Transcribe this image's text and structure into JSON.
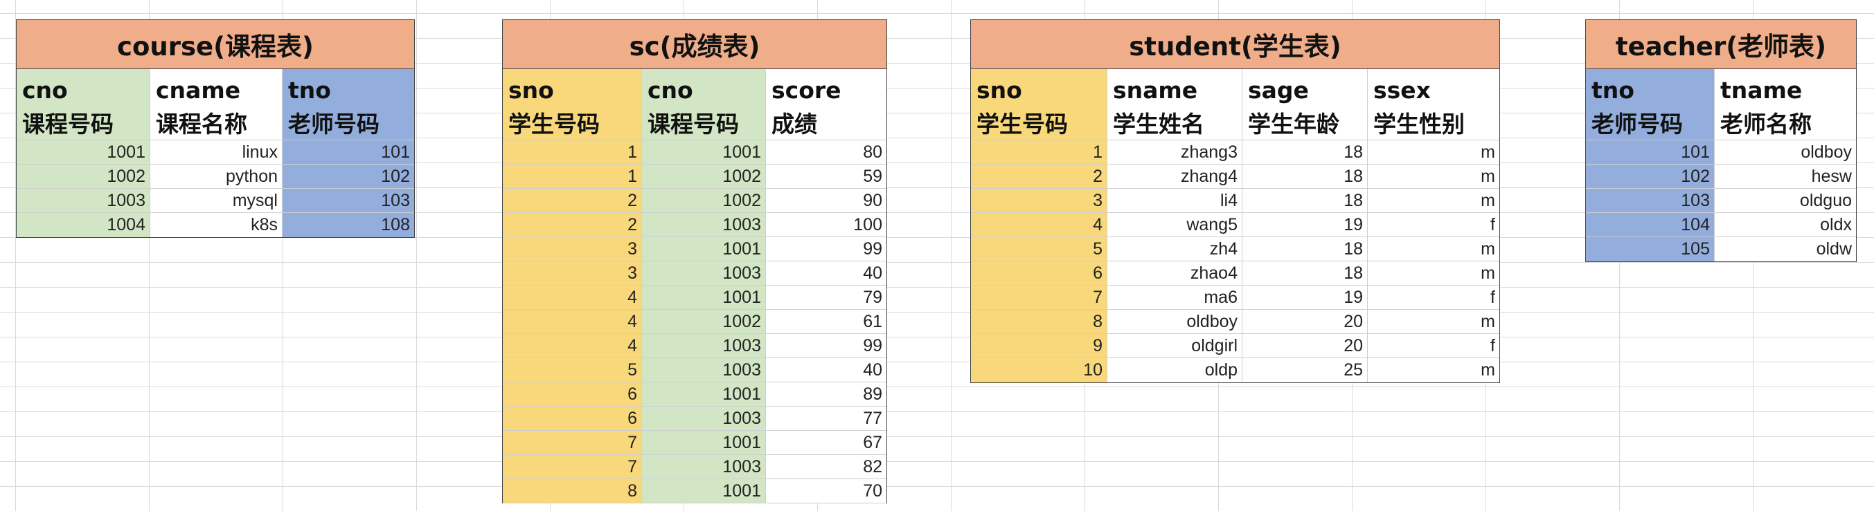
{
  "colors": {
    "title_bg": "#efad8a",
    "yellow": "#f8d87a",
    "green": "#d2e6c6",
    "blue": "#93aedd"
  },
  "course": {
    "title": "course(课程表)",
    "columns": [
      {
        "name": "cno",
        "label": "课程号码",
        "color": "green",
        "values": [
          "1001",
          "1002",
          "1003",
          "1004"
        ]
      },
      {
        "name": "cname",
        "label": "课程名称",
        "color": "white",
        "values": [
          "linux",
          "python",
          "mysql",
          "k8s"
        ]
      },
      {
        "name": "tno",
        "label": "老师号码",
        "color": "blue",
        "values": [
          "101",
          "102",
          "103",
          "108"
        ]
      }
    ]
  },
  "sc": {
    "title": "sc(成绩表)",
    "columns": [
      {
        "name": "sno",
        "label": "学生号码",
        "color": "yellow",
        "values": [
          "1",
          "1",
          "2",
          "2",
          "3",
          "3",
          "4",
          "4",
          "4",
          "5",
          "6",
          "6",
          "7",
          "7",
          "8"
        ]
      },
      {
        "name": "cno",
        "label": "课程号码",
        "color": "green",
        "values": [
          "1001",
          "1002",
          "1002",
          "1003",
          "1001",
          "1003",
          "1001",
          "1002",
          "1003",
          "1003",
          "1001",
          "1003",
          "1001",
          "1003",
          "1001"
        ]
      },
      {
        "name": "score",
        "label": "成绩",
        "color": "white",
        "values": [
          "80",
          "59",
          "90",
          "100",
          "99",
          "40",
          "79",
          "61",
          "99",
          "40",
          "89",
          "77",
          "67",
          "82",
          "70"
        ]
      }
    ]
  },
  "student": {
    "title": "student(学生表)",
    "columns": [
      {
        "name": "sno",
        "label": "学生号码",
        "color": "yellow",
        "values": [
          "1",
          "2",
          "3",
          "4",
          "5",
          "6",
          "7",
          "8",
          "9",
          "10"
        ]
      },
      {
        "name": "sname",
        "label": "学生姓名",
        "color": "white",
        "values": [
          "zhang3",
          "zhang4",
          "li4",
          "wang5",
          "zh4",
          "zhao4",
          "ma6",
          "oldboy",
          "oldgirl",
          "oldp"
        ]
      },
      {
        "name": "sage",
        "label": "学生年龄",
        "color": "white",
        "values": [
          "18",
          "18",
          "18",
          "19",
          "18",
          "18",
          "19",
          "20",
          "20",
          "25"
        ]
      },
      {
        "name": "ssex",
        "label": "学生性别",
        "color": "white",
        "values": [
          "m",
          "m",
          "m",
          "f",
          "m",
          "m",
          "f",
          "m",
          "f",
          "m"
        ]
      }
    ]
  },
  "teacher": {
    "title": "teacher(老师表)",
    "columns": [
      {
        "name": "tno",
        "label": "老师号码",
        "color": "blue",
        "values": [
          "101",
          "102",
          "103",
          "104",
          "105"
        ]
      },
      {
        "name": "tname",
        "label": "老师名称",
        "color": "white",
        "values": [
          "oldboy",
          "hesw",
          "oldguo",
          "oldx",
          "oldw"
        ]
      }
    ]
  }
}
